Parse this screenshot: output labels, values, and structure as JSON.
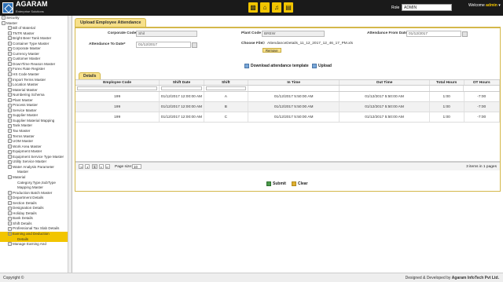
{
  "header": {
    "logo_text": "AGARAM",
    "logo_sub": "Enterprise Solutions",
    "icons": [
      "briefcase-icon",
      "home-icon",
      "bell-icon",
      "chart-icon"
    ],
    "role_label": "Role",
    "role_value": "ADMIN",
    "welcome_prefix": "Welcome",
    "welcome_user": "admin"
  },
  "sidebar": {
    "items": [
      {
        "label": "Security",
        "level": 0,
        "toggle": "+"
      },
      {
        "label": "Master",
        "level": 0,
        "toggle": "−"
      },
      {
        "label": "Bill of Material",
        "level": 1,
        "toggle": "+"
      },
      {
        "label": "TNTR Master",
        "level": 1,
        "toggle": "+"
      },
      {
        "label": "Bright Beer Tank Master",
        "level": 1,
        "toggle": "+"
      },
      {
        "label": "Container Type Master",
        "level": 1,
        "toggle": "+"
      },
      {
        "label": "Corporate Master",
        "level": 1,
        "toggle": "+"
      },
      {
        "label": "Currency Master",
        "level": 1,
        "toggle": "+"
      },
      {
        "label": "Customer Master",
        "level": 1,
        "toggle": "+"
      },
      {
        "label": "DownTime Reason Master",
        "level": 1,
        "toggle": "+"
      },
      {
        "label": "Forex Rate Register",
        "level": 1,
        "toggle": "+"
      },
      {
        "label": "HS Code Master",
        "level": 1,
        "toggle": "+"
      },
      {
        "label": "Import Terms Master",
        "level": 1,
        "toggle": "+"
      },
      {
        "label": "Location Master",
        "level": 1,
        "toggle": "+"
      },
      {
        "label": "Material Master",
        "level": 1,
        "toggle": "+"
      },
      {
        "label": "Numbering Schema",
        "level": 1,
        "toggle": "+"
      },
      {
        "label": "Plant Master",
        "level": 1,
        "toggle": "+"
      },
      {
        "label": "Process Master",
        "level": 1,
        "toggle": "+"
      },
      {
        "label": "Service Master",
        "level": 1,
        "toggle": "+"
      },
      {
        "label": "Supplier Master",
        "level": 1,
        "toggle": "+"
      },
      {
        "label": "Supplier Material Mapping",
        "level": 1,
        "toggle": "+"
      },
      {
        "label": "Tank Master",
        "level": 1,
        "toggle": "+"
      },
      {
        "label": "Tax Master",
        "level": 1,
        "toggle": "+"
      },
      {
        "label": "Terms Master",
        "level": 1,
        "toggle": "+"
      },
      {
        "label": "UOM Master",
        "level": 1,
        "toggle": "+"
      },
      {
        "label": "Work Area Master",
        "level": 1,
        "toggle": "+"
      },
      {
        "label": "Equipment Master",
        "level": 1,
        "toggle": "+"
      },
      {
        "label": "Equipment Service Type Master",
        "level": 1,
        "toggle": "+"
      },
      {
        "label": "Utility Service Master",
        "level": 1,
        "toggle": "+"
      },
      {
        "label": "Water Analysis Parameter",
        "level": 1,
        "toggle": "+"
      },
      {
        "label": "Master",
        "level": 2,
        "toggle": ""
      },
      {
        "label": "Material",
        "level": 1,
        "toggle": "+"
      },
      {
        "label": "Category,Type,SubType",
        "level": 2,
        "toggle": ""
      },
      {
        "label": "Mapping Master",
        "level": 2,
        "toggle": ""
      },
      {
        "label": "Production Batch Master",
        "level": 1,
        "toggle": "+"
      },
      {
        "label": "Department Details",
        "level": 1,
        "toggle": "+"
      },
      {
        "label": "Section Details",
        "level": 1,
        "toggle": "+"
      },
      {
        "label": "Designation Details",
        "level": 1,
        "toggle": "+"
      },
      {
        "label": "Holiday Details",
        "level": 1,
        "toggle": "+"
      },
      {
        "label": "Bank Details",
        "level": 1,
        "toggle": "+"
      },
      {
        "label": "Shift Details",
        "level": 1,
        "toggle": "+"
      },
      {
        "label": "Professional Tax Slab Details",
        "level": 1,
        "toggle": "+"
      },
      {
        "label": "Earning and Deduction",
        "level": 1,
        "toggle": "+",
        "active": true
      },
      {
        "label": "Details",
        "level": 2,
        "toggle": "",
        "active": true
      },
      {
        "label": "Manage Earning And",
        "level": 1,
        "toggle": "+"
      }
    ]
  },
  "form": {
    "title": "Upload Employee Attendance",
    "corporate_code_label": "Corporate Code",
    "corporate_code_value": "Shil",
    "plant_code_label": "Plant Code",
    "plant_code_value": "BREW",
    "from_date_label": "Attendance From Date*",
    "from_date_value": "01/12/2017",
    "to_date_label": "Attendance To Date*",
    "to_date_value": "01/12/2017",
    "choose_file_label": "Choose File",
    "file_name": "AttendanceDetails_11_12_2017_12_46_17_PM.xls",
    "remove_label": "Remove",
    "download_label": "Download attendance template",
    "upload_label": "Upload"
  },
  "details": {
    "tab_label": "Details",
    "columns": [
      "Employee Code",
      "Shift Date",
      "Shift",
      "In Time",
      "Out Time",
      "Total Hours",
      "OT Hours"
    ],
    "rows": [
      [
        "199",
        "01/12/2017 12:00:00 AM",
        "A",
        "01/12/2017 5:50:00 AM",
        "01/12/2017 5:50:00 AM",
        "1:00",
        "-7:00"
      ],
      [
        "199",
        "01/12/2017 12:00:00 AM",
        "B",
        "01/12/2017 5:50:00 AM",
        "01/12/2017 5:50:00 AM",
        "1:00",
        "-7:00"
      ],
      [
        "199",
        "01/12/2017 12:00:00 AM",
        "C",
        "01/12/2017 5:50:00 AM",
        "01/12/2017 5:50:00 AM",
        "1:00",
        "-7:00"
      ]
    ],
    "pager": {
      "first": "|◂",
      "prev": "◂",
      "page": "1",
      "next": "▸",
      "last": "▸|",
      "page_size_label": "Page size:",
      "page_size": "10",
      "info": "3 items in 1 pages"
    }
  },
  "actions": {
    "submit_label": "Submit",
    "clear_label": "Clear"
  },
  "footer": {
    "copyright": "Copyright ©",
    "designed_prefix": "Designed & Developed by",
    "company": "Agaram InfoTech Pvt Ltd."
  }
}
